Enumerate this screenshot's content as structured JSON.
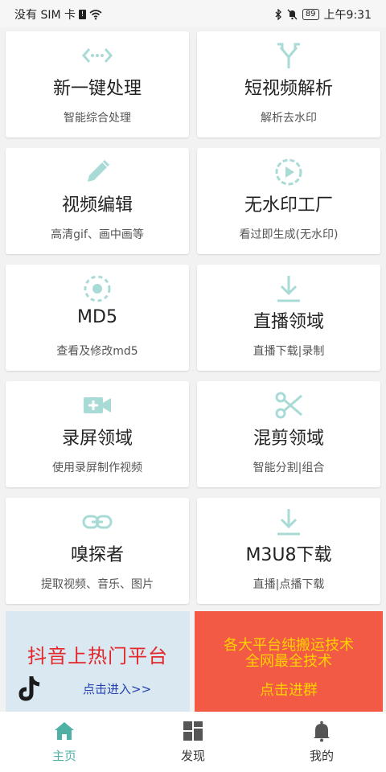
{
  "status": {
    "carrier": "没有 SIM 卡",
    "battery": "89",
    "time": "上午9:31"
  },
  "cards": [
    {
      "icon": "code-arrows-icon",
      "title": "新一键处理",
      "subtitle": "智能综合处理"
    },
    {
      "icon": "merge-arrows-icon",
      "title": "短视频解析",
      "subtitle": "解析去水印"
    },
    {
      "icon": "pencil-icon",
      "title": "视频编辑",
      "subtitle": "高清gif、画中画等"
    },
    {
      "icon": "play-circle-icon",
      "title": "无水印工厂",
      "subtitle": "看过即生成(无水印)"
    },
    {
      "icon": "target-icon",
      "title": "MD5",
      "subtitle": "查看及修改md5"
    },
    {
      "icon": "download-icon",
      "title": "直播领域",
      "subtitle": "直播下载|录制"
    },
    {
      "icon": "video-camera-plus-icon",
      "title": "录屏领域",
      "subtitle": "使用录屏制作视频"
    },
    {
      "icon": "scissors-icon",
      "title": "混剪领域",
      "subtitle": "智能分割|组合"
    },
    {
      "icon": "link-icon",
      "title": "嗅探者",
      "subtitle": "提取视频、音乐、图片"
    },
    {
      "icon": "download-icon",
      "title": "M3U8下载",
      "subtitle": "直播|点播下载"
    }
  ],
  "banner_left": {
    "title": "抖音上热门平台",
    "link": "点击进入>>"
  },
  "banner_right": {
    "line1": "各大平台纯搬运技术",
    "line2": "全网最全技术",
    "link": "点击进群"
  },
  "tabs": [
    {
      "label": "主页",
      "icon": "home-icon",
      "active": true
    },
    {
      "label": "发现",
      "icon": "grid-icon",
      "active": false
    },
    {
      "label": "我的",
      "icon": "bell-icon",
      "active": false
    }
  ],
  "colors": {
    "accent": "#4fb0a6",
    "icon_tint": "#a9dbd6",
    "banner_left_bg": "#d9e8f1",
    "banner_right_bg": "#f25a45"
  }
}
